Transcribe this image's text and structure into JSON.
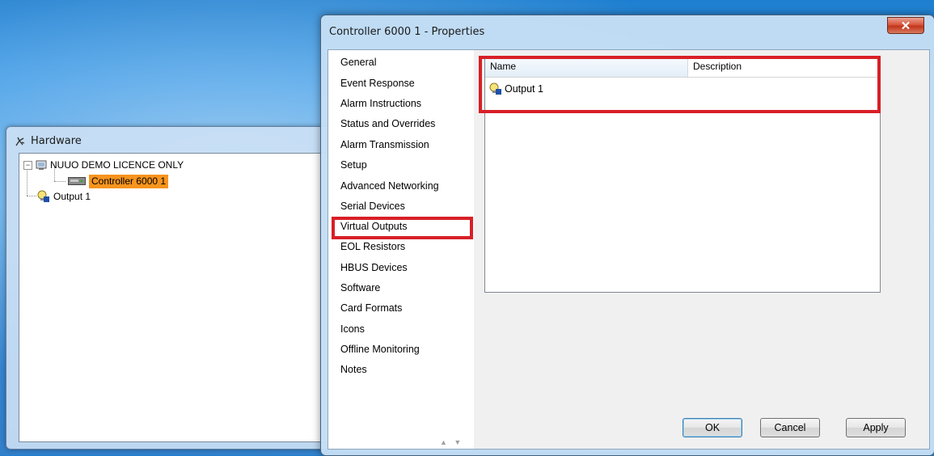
{
  "hardware_window": {
    "title": "Hardware",
    "tree": {
      "root_label": "NUUO DEMO LICENCE ONLY",
      "expander_symbol": "−",
      "controller_label": "Controller 6000 1",
      "output_label": "Output 1"
    }
  },
  "dialog": {
    "title": "Controller 6000 1 - Properties",
    "nav_items": [
      "General",
      "Event Response",
      "Alarm Instructions",
      "Status and Overrides",
      "Alarm Transmission",
      "Setup",
      "Advanced Networking",
      "Serial Devices",
      "Virtual Outputs",
      "EOL Resistors",
      "HBUS Devices",
      "Software",
      "Card Formats",
      "Icons",
      "Offline Monitoring",
      "Notes"
    ],
    "selected_nav": "Virtual Outputs",
    "list": {
      "columns": [
        "Name",
        "Description"
      ],
      "rows": [
        {
          "name": "Output 1",
          "description": ""
        }
      ]
    },
    "scroll_arrows": "▲ ▼",
    "buttons": {
      "ok": "OK",
      "cancel": "Cancel",
      "apply": "Apply"
    }
  },
  "colors": {
    "highlight_box": "#d81f26",
    "selected_node": "#f7941d",
    "close_button": "#c1361c"
  }
}
